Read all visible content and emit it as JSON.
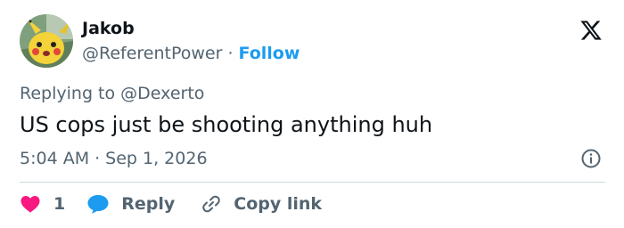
{
  "author": {
    "display_name": "Jakob",
    "handle": "@ReferentPower",
    "separator": "·",
    "follow_label": "Follow"
  },
  "reply_context": {
    "prefix": "Replying to",
    "mention": "@Dexerto"
  },
  "tweet": {
    "text": "US cops just be shooting anything huh"
  },
  "meta": {
    "time": "5:04 AM",
    "separator": "·",
    "date": "Sep 1, 2026"
  },
  "actions": {
    "like_count": "1",
    "reply_label": "Reply",
    "copy_link_label": "Copy link"
  },
  "icons": {
    "logo": "x-logo-icon",
    "info": "info-icon",
    "like": "heart-icon",
    "reply": "speech-bubble-icon",
    "copy": "link-icon"
  },
  "colors": {
    "accent": "#1d9bf0",
    "like": "#f91880",
    "text": "#0f1419",
    "muted": "#536471",
    "divider": "#cfd9de"
  }
}
